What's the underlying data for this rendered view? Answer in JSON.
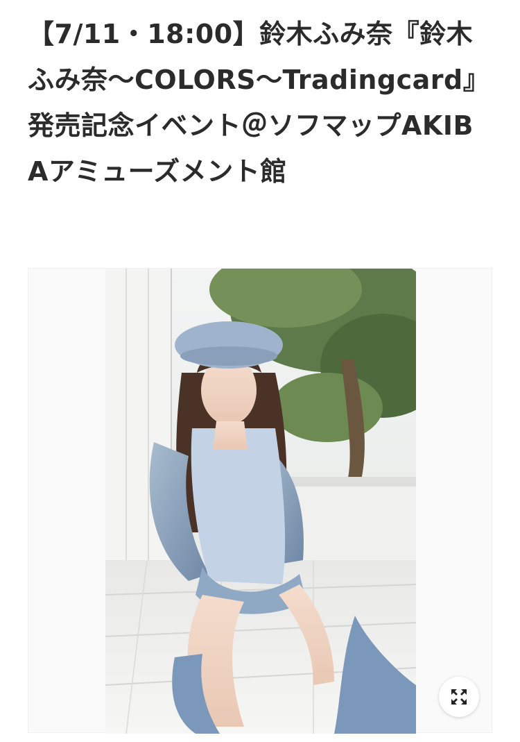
{
  "article": {
    "title": "【7/11・18:00】鈴木ふみ奈『鈴木ふみ奈〜COLORS〜Tradingcard』発売記念イベント＠ソフマップAKIBAアミューズメント館"
  },
  "image": {
    "expand_icon": "expand-arrows-icon"
  },
  "colors": {
    "title_text": "#2b2b2b",
    "card_background": "#fafafa",
    "button_background": "#ffffff"
  }
}
